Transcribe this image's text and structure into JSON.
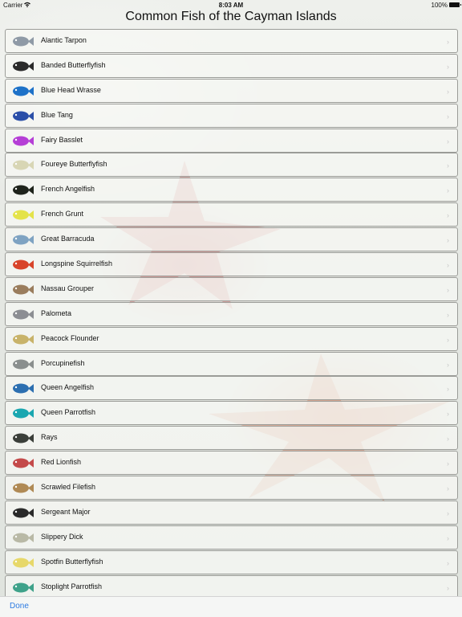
{
  "status_bar": {
    "carrier": "Carrier",
    "time": "8:03 AM",
    "battery": "100%"
  },
  "title": "Common Fish of the Cayman Islands",
  "fish": [
    {
      "name": "Alantic Tarpon",
      "icon": "tarpon-icon",
      "color": "#8f9aa6"
    },
    {
      "name": "Banded Butterflyfish",
      "icon": "banded-butterflyfish-icon",
      "color": "#2a2a2a"
    },
    {
      "name": "Blue Head Wrasse",
      "icon": "blue-head-wrasse-icon",
      "color": "#1e72c8"
    },
    {
      "name": "Blue Tang",
      "icon": "blue-tang-icon",
      "color": "#2b4fa8"
    },
    {
      "name": "Fairy Basslet",
      "icon": "fairy-basslet-icon",
      "color": "#b53fd6"
    },
    {
      "name": "Foureye Butterflyfish",
      "icon": "foureye-butterflyfish-icon",
      "color": "#d8d6b5"
    },
    {
      "name": "French Angelfish",
      "icon": "french-angelfish-icon",
      "color": "#1f241c"
    },
    {
      "name": "French Grunt",
      "icon": "french-grunt-icon",
      "color": "#e4e34a"
    },
    {
      "name": "Great Barracuda",
      "icon": "great-barracuda-icon",
      "color": "#7fa3c2"
    },
    {
      "name": "Longspine Squirrelfish",
      "icon": "longspine-squirrelfish-icon",
      "color": "#d8442a"
    },
    {
      "name": "Nassau Grouper",
      "icon": "nassau-grouper-icon",
      "color": "#9a7d5d"
    },
    {
      "name": "Palometa",
      "icon": "palometa-icon",
      "color": "#8c8e93"
    },
    {
      "name": "Peacock Flounder",
      "icon": "peacock-flounder-icon",
      "color": "#c8b36a"
    },
    {
      "name": "Porcupinefish",
      "icon": "porcupinefish-icon",
      "color": "#8a8f8e"
    },
    {
      "name": "Queen Angelfish",
      "icon": "queen-angelfish-icon",
      "color": "#2c6fb0"
    },
    {
      "name": "Queen Parrotfish",
      "icon": "queen-parrotfish-icon",
      "color": "#1aa7b0"
    },
    {
      "name": "Rays",
      "icon": "rays-icon",
      "color": "#3b3f3a"
    },
    {
      "name": "Red Lionfish",
      "icon": "red-lionfish-icon",
      "color": "#c44a4a"
    },
    {
      "name": "Scrawled Filefish",
      "icon": "scrawled-filefish-icon",
      "color": "#b08a55"
    },
    {
      "name": "Sergeant Major",
      "icon": "sergeant-major-icon",
      "color": "#2a2a2a"
    },
    {
      "name": "Slippery Dick",
      "icon": "slippery-dick-icon",
      "color": "#b9b9a6"
    },
    {
      "name": "Spotfin Butterflyfish",
      "icon": "spotfin-butterflyfish-icon",
      "color": "#e7d86a"
    },
    {
      "name": "Stoplight Parrotfish",
      "icon": "stoplight-parrotfish-icon",
      "color": "#3fa28a"
    }
  ],
  "chevron": "›",
  "toolbar": {
    "done_label": "Done"
  },
  "colors": {
    "accent": "#2d7be1",
    "row_border": "#9b9c98"
  }
}
